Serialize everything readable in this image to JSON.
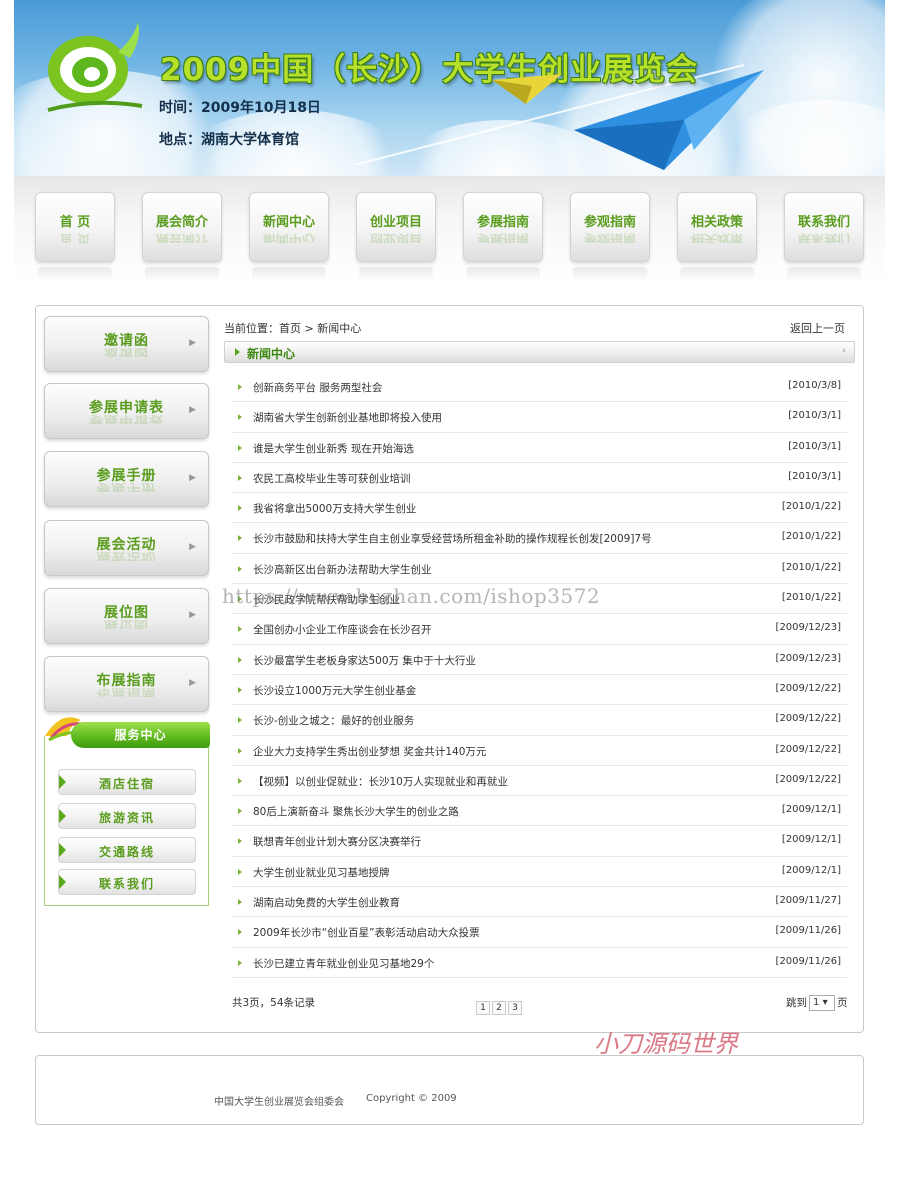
{
  "banner": {
    "title": "2009中国（长沙）大学生创业展览会",
    "time": "时间：2009年10月18日",
    "place": "地点：湖南大学体育馆"
  },
  "nav": [
    "首  页",
    "展会简介",
    "新闻中心",
    "创业项目",
    "参展指南",
    "参观指南",
    "相关政策",
    "联系我们"
  ],
  "sidebar": {
    "items": [
      "邀请函",
      "参展申请表",
      "参展手册",
      "展会活动",
      "展位图",
      "布展指南"
    ],
    "service_title": "服务中心",
    "service_items": [
      "酒店住宿",
      "旅游资讯",
      "交通路线",
      "联系我们"
    ]
  },
  "breadcrumb": {
    "prefix": "当前位置：",
    "home": "首页",
    "sep": ">",
    "current": "新闻中心",
    "back": "返回上一页"
  },
  "section_title": "新闻中心",
  "section_more": "›",
  "news": [
    {
      "title": "创新商务平台  服务两型社会",
      "date": "[2010/3/8]"
    },
    {
      "title": "湖南省大学生创新创业基地即将投入使用",
      "date": "[2010/3/1]"
    },
    {
      "title": "谁是大学生创业新秀 现在开始海选",
      "date": "[2010/3/1]"
    },
    {
      "title": "农民工高校毕业生等可获创业培训",
      "date": "[2010/3/1]"
    },
    {
      "title": "我省将拿出5000万支持大学生创业",
      "date": "[2010/1/22]"
    },
    {
      "title": "长沙市鼓励和扶持大学生自主创业享受经营场所租金补助的操作规程长创发[2009]7号",
      "date": "[2010/1/22]"
    },
    {
      "title": "长沙高新区出台新办法帮助大学生创业",
      "date": "[2010/1/22]"
    },
    {
      "title": "长沙民政学院帮扶帮助学生创业",
      "date": "[2010/1/22]"
    },
    {
      "title": "全国创办小企业工作座谈会在长沙召开",
      "date": "[2009/12/23]"
    },
    {
      "title": "长沙最富学生老板身家达500万  集中于十大行业",
      "date": "[2009/12/23]"
    },
    {
      "title": "长沙设立1000万元大学生创业基金",
      "date": "[2009/12/22]"
    },
    {
      "title": "长沙-创业之城之：最好的创业服务",
      "date": "[2009/12/22]"
    },
    {
      "title": "企业大力支持学生秀出创业梦想  奖金共计140万元",
      "date": "[2009/12/22]"
    },
    {
      "title": "【视频】以创业促就业：长沙10万人实现就业和再就业",
      "date": "[2009/12/22]"
    },
    {
      "title": "80后上演新奋斗  聚焦长沙大学生的创业之路",
      "date": "[2009/12/1]"
    },
    {
      "title": "联想青年创业计划大赛分区决赛举行",
      "date": "[2009/12/1]"
    },
    {
      "title": "大学生创业就业见习基地授牌",
      "date": "[2009/12/1]"
    },
    {
      "title": "湖南启动免费的大学生创业教育",
      "date": "[2009/11/27]"
    },
    {
      "title": "2009年长沙市“创业百星”表彰活动启动大众投票",
      "date": "[2009/11/26]"
    },
    {
      "title": "长沙已建立青年就业创业见习基地29个",
      "date": "[2009/11/26]"
    }
  ],
  "pagination": {
    "summary": "共3页，54条记录",
    "pages": [
      "1",
      "2",
      "3"
    ],
    "jump_prefix": "跳到",
    "jump_value": "1",
    "jump_arrow": "▾",
    "jump_suffix": "页"
  },
  "watermarks": {
    "url": "https://www.huzhan.com/ishop3572",
    "brand": "小刀源码世界"
  },
  "footer": {
    "org": "中国大学生创业展览会组委会",
    "copyright": "Copyright © 2009"
  },
  "colors": {
    "accent_green": "#5a9d1e",
    "title_green": "#b6e02a",
    "sky_blue": "#4a9ad6"
  }
}
